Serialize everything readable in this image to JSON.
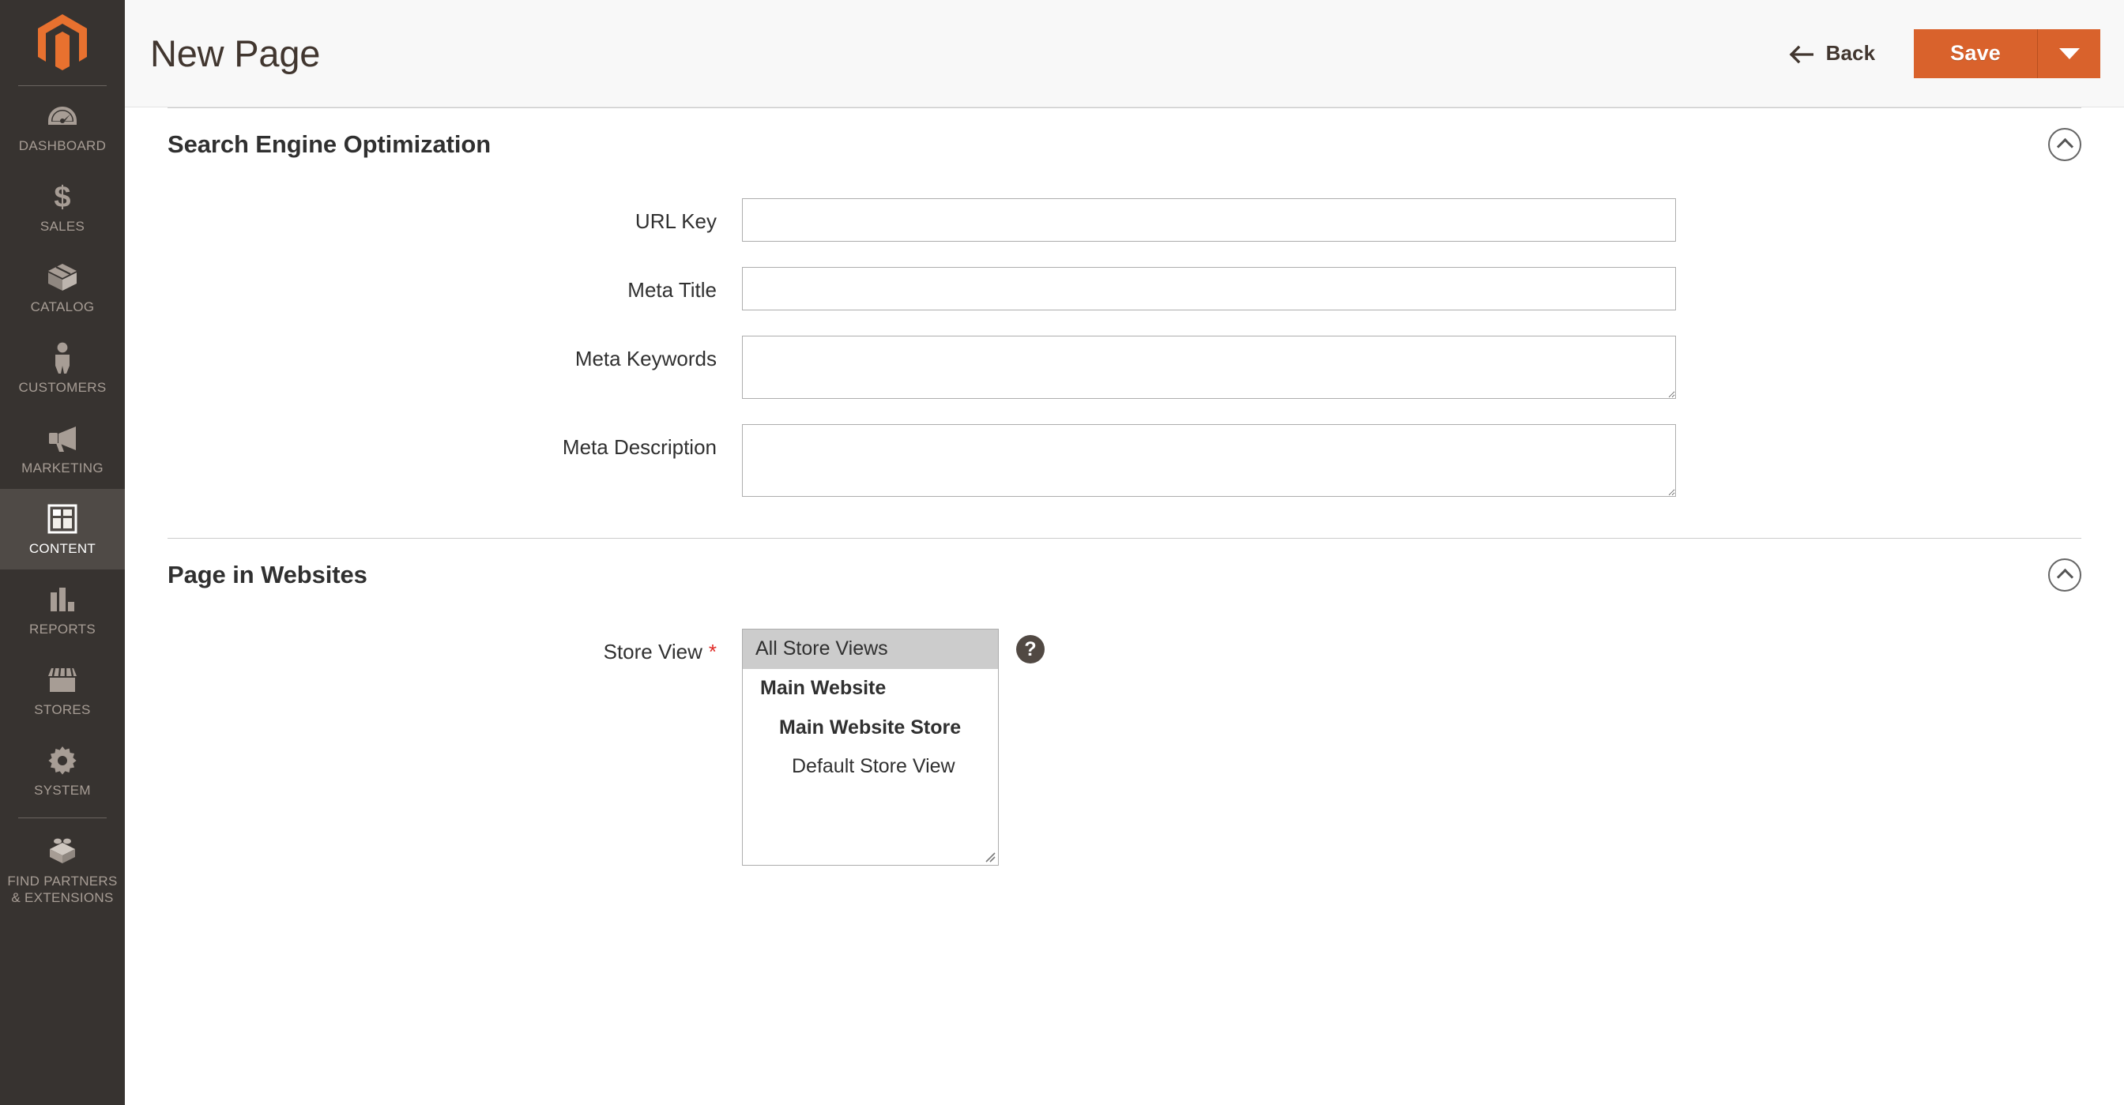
{
  "brand": {
    "logo_name": "magento-logo",
    "accent_color": "#d9622c",
    "sidebar_bg": "#373330"
  },
  "sidebar": {
    "items": [
      {
        "label": "DASHBOARD",
        "icon": "dashboard-gauge-icon",
        "active": false
      },
      {
        "label": "SALES",
        "icon": "dollar-sign-icon",
        "active": false
      },
      {
        "label": "CATALOG",
        "icon": "box-icon",
        "active": false
      },
      {
        "label": "CUSTOMERS",
        "icon": "person-icon",
        "active": false
      },
      {
        "label": "MARKETING",
        "icon": "megaphone-icon",
        "active": false
      },
      {
        "label": "CONTENT",
        "icon": "layout-blocks-icon",
        "active": true
      },
      {
        "label": "REPORTS",
        "icon": "bar-chart-icon",
        "active": false
      },
      {
        "label": "STORES",
        "icon": "storefront-icon",
        "active": false
      },
      {
        "label": "SYSTEM",
        "icon": "gear-icon",
        "active": false
      },
      {
        "label": "FIND PARTNERS & EXTENSIONS",
        "icon": "lego-brick-icon",
        "active": false
      }
    ]
  },
  "header": {
    "title": "New Page",
    "back_label": "Back",
    "back_icon": "arrow-left-icon",
    "save_label": "Save",
    "save_caret_icon": "caret-down-icon"
  },
  "sections": [
    {
      "id": "seo",
      "title": "Search Engine Optimization",
      "collapse_icon": "chevron-up-circle-icon",
      "fields": [
        {
          "id": "url_key",
          "label": "URL Key",
          "type": "text",
          "value": "",
          "placeholder": "",
          "required": false
        },
        {
          "id": "meta_title",
          "label": "Meta Title",
          "type": "text",
          "value": "",
          "placeholder": "",
          "required": false
        },
        {
          "id": "meta_keywords",
          "label": "Meta Keywords",
          "type": "textarea",
          "value": "",
          "placeholder": "",
          "required": false
        },
        {
          "id": "meta_description",
          "label": "Meta Description",
          "type": "textarea",
          "value": "",
          "placeholder": "",
          "required": false
        }
      ]
    },
    {
      "id": "page_in_websites",
      "title": "Page in Websites",
      "collapse_icon": "chevron-up-circle-icon",
      "store_view": {
        "label": "Store View",
        "required": true,
        "required_marker": "*",
        "help_icon": "question-mark-circle-icon",
        "options": [
          {
            "label": "All Store Views",
            "level": 0,
            "selected": true
          },
          {
            "label": "Main Website",
            "level": 1,
            "selected": false
          },
          {
            "label": "Main Website Store",
            "level": 2,
            "selected": false
          },
          {
            "label": "Default Store View",
            "level": 3,
            "selected": false
          }
        ]
      }
    }
  ]
}
